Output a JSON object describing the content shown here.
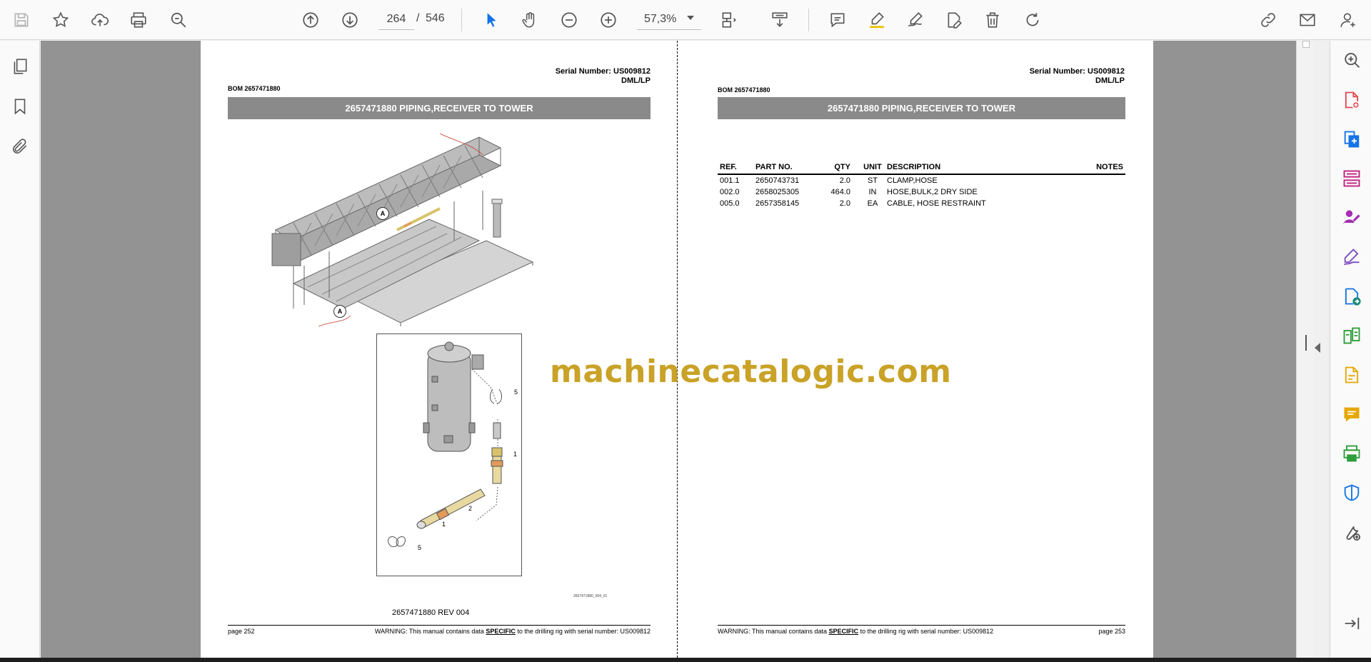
{
  "toolbar": {
    "page_current": "264",
    "page_separator": "/",
    "page_total": "546",
    "zoom": "57,3%",
    "icons": [
      "save-icon",
      "star-icon",
      "cloud-upload-icon",
      "print-icon",
      "search-zoom-icon",
      "prev-page-icon",
      "next-page-icon",
      "select-cursor-icon",
      "hand-icon",
      "zoom-out-icon",
      "zoom-in-icon",
      "page-fit-icon",
      "scroll-mode-icon",
      "comment-icon",
      "highlight-icon",
      "sign-icon",
      "edit-pdf-icon",
      "delete-icon",
      "rotate-icon",
      "share-link-icon",
      "email-icon",
      "account-icon"
    ]
  },
  "left_nav": [
    "pages-icon",
    "bookmark-icon",
    "attachment-icon"
  ],
  "right_panel": [
    "zoom-search-icon",
    "create-pdf-icon",
    "export-pdf-icon",
    "organize-pages-icon",
    "request-signature-icon",
    "fill-sign-icon",
    "convert-pdf-icon",
    "compare-icon",
    "edit-doc-icon",
    "comment-panel-icon",
    "print-production-icon",
    "protect-icon",
    "more-tools-icon",
    "collapse-panel-icon"
  ],
  "colors": {
    "title_bar": "#8a8a8a",
    "watermark": "#c9a227",
    "accent_blue": "#1473e6",
    "acrobat_red": "#e34850"
  },
  "left_page": {
    "serial": "Serial Number: US009812",
    "sub": "DML/LP",
    "bom": "BOM 2657471880",
    "title": "2657471880 PIPING,RECEIVER TO TOWER",
    "callout_main": "A",
    "callout_detail": "A",
    "detail_labels": [
      "5",
      "1",
      "2",
      "1",
      "5"
    ],
    "drawing_ref": "2657471880_004_01",
    "rev": "2657471880 REV 004",
    "footer_page": "page 252",
    "footer_warning_pre": "WARNING:  This manual contains data ",
    "footer_warning_em": "SPECIFIC",
    "footer_warning_post": " to the drilling rig with serial number: US009812"
  },
  "right_page": {
    "serial": "Serial Number: US009812",
    "sub": "DML/LP",
    "bom": "BOM 2657471880",
    "title": "2657471880 PIPING,RECEIVER TO TOWER",
    "headers": {
      "ref": "REF.",
      "part": "PART NO.",
      "qty": "QTY",
      "unit": "UNIT",
      "desc": "DESCRIPTION",
      "notes": "NOTES"
    },
    "rows": [
      {
        "ref": "001.1",
        "part": "2650743731",
        "qty": "2.0",
        "unit": "ST",
        "desc": "CLAMP,HOSE",
        "notes": ""
      },
      {
        "ref": "002.0",
        "part": "2658025305",
        "qty": "464.0",
        "unit": "IN",
        "desc": "HOSE,BULK,2 DRY SIDE",
        "notes": ""
      },
      {
        "ref": "005.0",
        "part": "2657358145",
        "qty": "2.0",
        "unit": "EA",
        "desc": "CABLE, HOSE RESTRAINT",
        "notes": ""
      }
    ],
    "footer_page": "page 253",
    "footer_warning_pre": "WARNING:  This manual contains data ",
    "footer_warning_em": "SPECIFIC",
    "footer_warning_post": " to the drilling rig with serial number: US009812"
  },
  "watermark": "machinecatalogic.com"
}
